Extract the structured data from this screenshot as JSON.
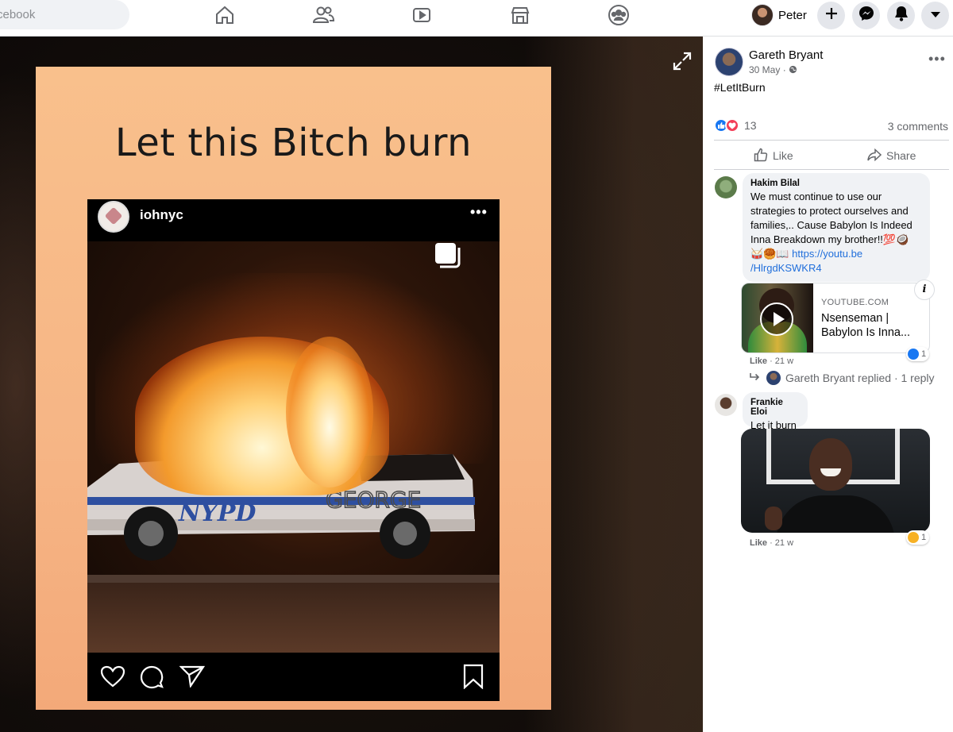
{
  "topbar": {
    "search_placeholder": "cebook",
    "profile_name": "Peter",
    "nav_icons": [
      "home-icon",
      "friends-icon",
      "watch-icon",
      "marketplace-icon",
      "groups-icon"
    ],
    "action_icons": [
      "plus-icon",
      "messenger-icon",
      "notifications-icon",
      "account-menu-icon"
    ]
  },
  "image": {
    "caption": "Let this Bitch burn",
    "instagram": {
      "username": "iohnyc",
      "more": "•••"
    }
  },
  "post": {
    "author": "Gareth Bryant",
    "date": "30 May",
    "meta_sep": " · ",
    "text": "#LetItBurn",
    "reaction_count": "13",
    "comments_count": "3 comments",
    "like_label": "Like",
    "share_label": "Share",
    "menu": "•••"
  },
  "comments": [
    {
      "author": "Hakim Bilal",
      "text": "We must continue to use our strategies to protect ourselves and families,.. Cause Babylon Is Indeed Inna Breakdown my brother!!",
      "emoji": "💯🥥 🥁🥮📖 ",
      "link": "https://youtu.be/HlrgdKSWKR4",
      "link_line1": "https://youtu.be",
      "link_line2": "/HlrgdKSWKR4",
      "preview": {
        "source": "YOUTUBE.COM",
        "title": "Nsenseman | Babylon Is Inna..."
      },
      "like_label": "Like",
      "age": "21 w",
      "reactions": "1",
      "reply_summary": "Gareth Bryant replied · 1 reply"
    },
    {
      "author": "Frankie Eloi",
      "text": "Let it burn",
      "like_label": "Like",
      "age": "21 w",
      "reactions": "1"
    }
  ],
  "colors": {
    "brand": "#1877f2",
    "love": "#f33e58",
    "link": "#216fdb"
  }
}
